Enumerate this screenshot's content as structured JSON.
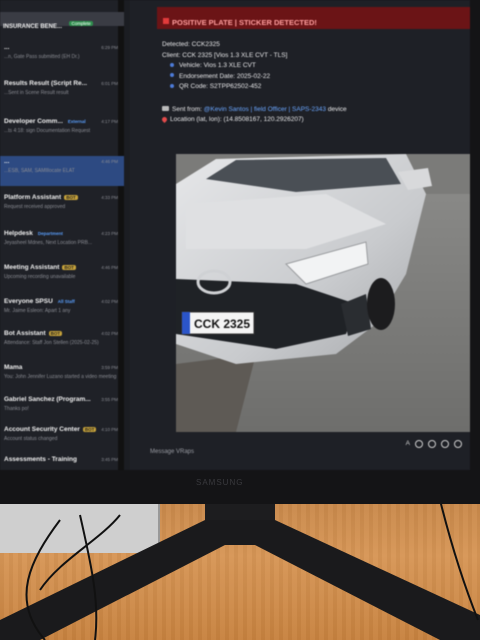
{
  "sidebar": {
    "header": {
      "title": "INSURANCE BENE...",
      "tag": "Complete"
    },
    "items": [
      {
        "title": "...",
        "sub": "...n, Gate Pass submitted (EH Dr.)",
        "time": "6:29 PM",
        "tag": ""
      },
      {
        "title": "Results Result (Script Re...",
        "sub": "...Sent in Scene Result result",
        "time": "6:01 PM",
        "tag": ""
      },
      {
        "title": "Developer Comm...",
        "sub": "...ts 4:18: sign Documentation Request",
        "time": "4:17 PM",
        "tag": "External"
      },
      {
        "title": "...",
        "sub": "...ESB, SAM, SAMIllocate ELAT",
        "time": "4:46 PM",
        "tag": ""
      },
      {
        "title": "Platform Assistant",
        "sub": "Request received approved",
        "time": "4:33 PM",
        "tag": "BOT"
      },
      {
        "title": "Helpdesk",
        "sub": "Jeyasheel Mdnes, Next Location PRB...",
        "time": "4:23 PM",
        "tag": "Department"
      },
      {
        "title": "Meeting Assistant",
        "sub": "Upcoming recording unavailable",
        "time": "4:46 PM",
        "tag": "BOT"
      },
      {
        "title": "Everyone SPSU",
        "sub": "Mr. Jaime Esleon: Apart 1 any",
        "time": "4:02 PM",
        "tag": "All Staff"
      },
      {
        "title": "Bot Assistant",
        "sub": "Attendance: Staff Jon Stellen (2025-02-25)",
        "time": "4:02 PM",
        "tag": "BOT"
      },
      {
        "title": "Mama",
        "sub": "You: John Jennifer Luzano started a video meeting",
        "time": "3:59 PM",
        "tag": ""
      },
      {
        "title": "Gabriel Sanchez (Program...",
        "sub": "Thanks po!",
        "time": "3:55 PM",
        "tag": ""
      },
      {
        "title": "Account Security Center",
        "sub": "Account status changed",
        "time": "4:10 PM",
        "tag": "BOT"
      },
      {
        "title": "Assessments - Training",
        "sub": "",
        "time": "3:45 PM",
        "tag": ""
      }
    ]
  },
  "message": {
    "header": "POSITIVE PLATE | STICKER DETECTED!",
    "detected_label": "Detected:",
    "detected_value": "CCK2325",
    "client_label": "Client:",
    "client_value": "CCK 2325 [Vios 1.3 XLE CVT - TLS]",
    "vehicle_label": "Vehicle:",
    "vehicle_value": "Vios 1.3 XLE CVT",
    "endorsement_label": "Endorsement Date:",
    "endorsement_value": "2025-02-22",
    "qr_label": "QR Code:",
    "qr_value": "S2TPP62502-452",
    "sent_label": "Sent from:",
    "sent_value": "@Kevin Santos | field Officer | SAPS-2343",
    "sent_suffix": "device",
    "location_label": "Location (lat, lon):",
    "location_value": "(14.8508167, 120.2926207)"
  },
  "car": {
    "plate": "CCK 2325"
  },
  "composer": {
    "placeholder": "Message VRaps"
  },
  "monitor": {
    "brand": "SAMSUNG"
  }
}
